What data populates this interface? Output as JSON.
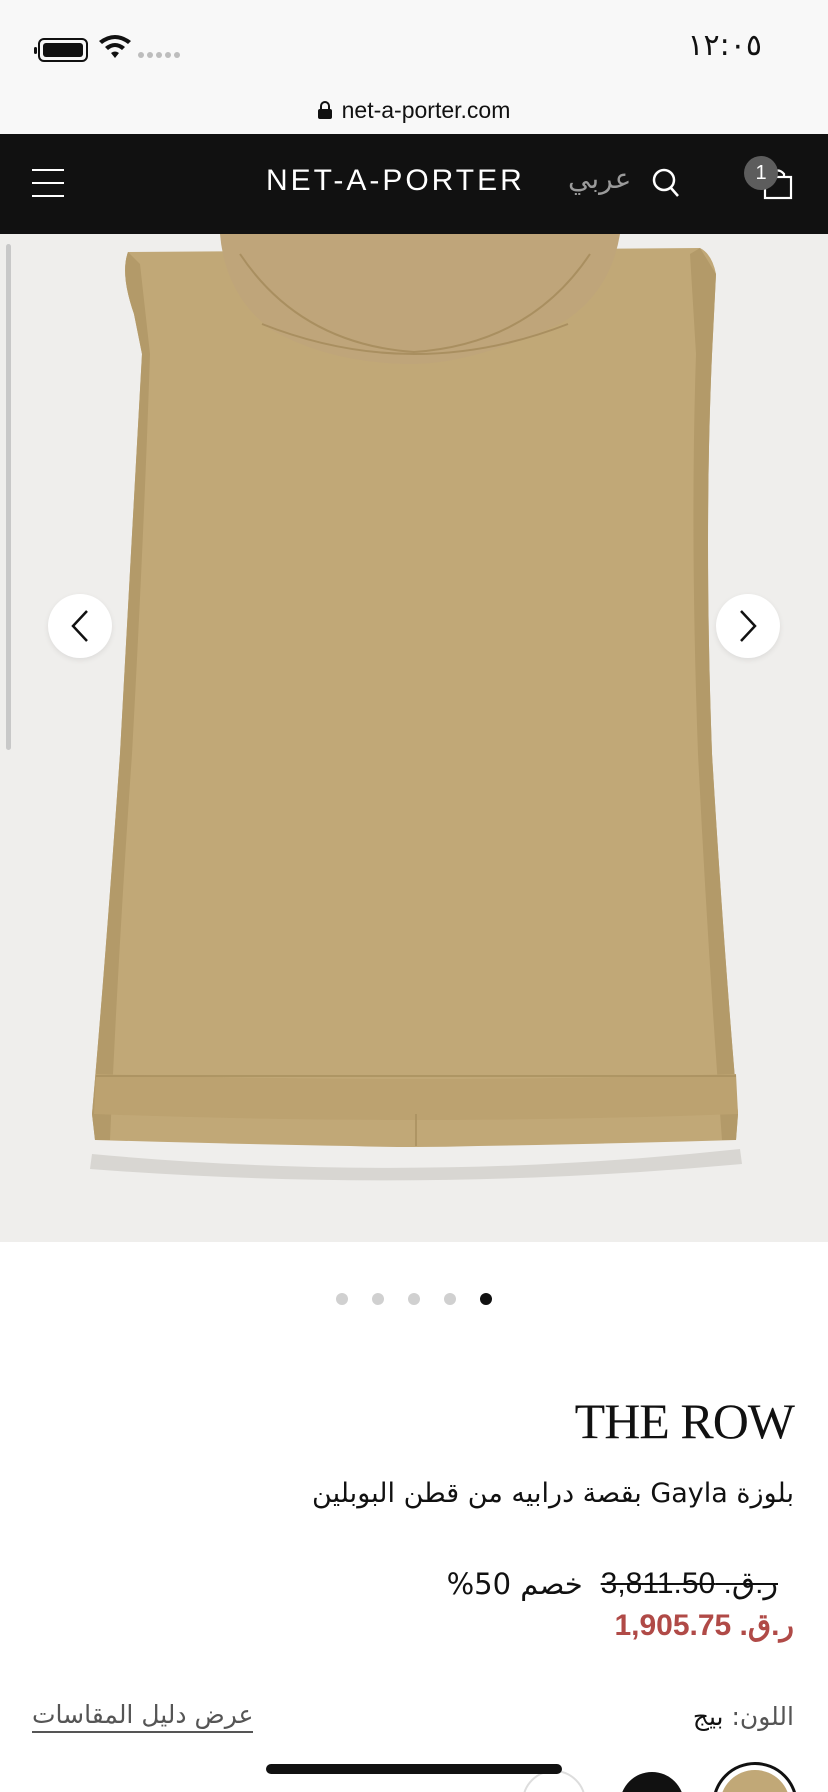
{
  "status_bar": {
    "time": "١٢:٠٥"
  },
  "browser": {
    "url": "net-a-porter.com"
  },
  "header": {
    "logo": "NET-A-PORTER",
    "language_toggle": "عربي",
    "cart_count": "1"
  },
  "gallery": {
    "image_count": 5,
    "active_index": 4,
    "product_color": "#c1a877"
  },
  "product": {
    "brand": "THE ROW",
    "name": "بلوزة Gayla بقصة درابيه من قطن البوبلين",
    "original_price": "ر.ق. 3,811.50",
    "discount": "خصم 50%",
    "sale_price": "ر.ق. 1,905.75",
    "sale_color": "#b04a47",
    "size_guide_label": "عرض دليل المقاسات",
    "color_label": "اللون:",
    "color_value": "بيج"
  }
}
